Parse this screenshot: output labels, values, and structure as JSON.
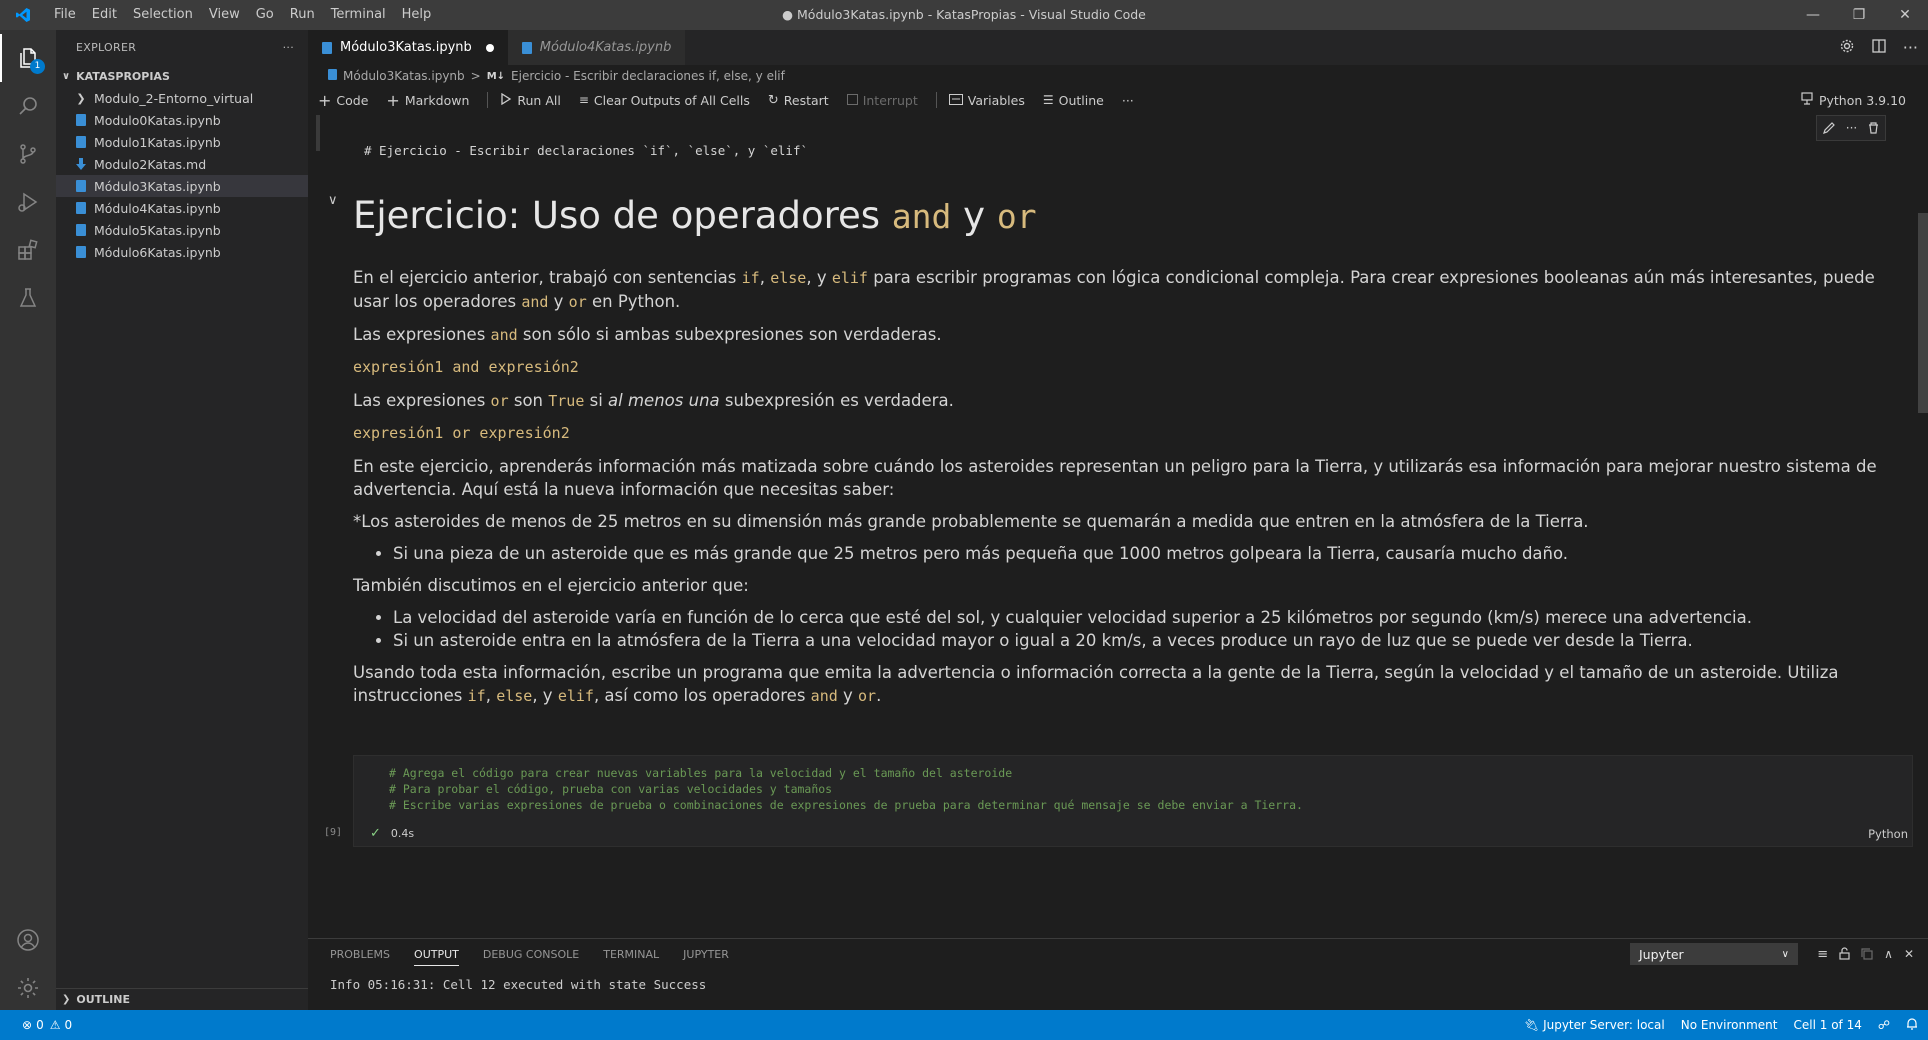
{
  "titlebar": {
    "menu": [
      "File",
      "Edit",
      "Selection",
      "View",
      "Go",
      "Run",
      "Terminal",
      "Help"
    ],
    "title": "● Módulo3Katas.ipynb - KatasPropias - Visual Studio Code"
  },
  "activity": {
    "explorer_badge": "1"
  },
  "sidebar": {
    "header": "EXPLORER",
    "section": "KATASPROPIAS",
    "items": [
      {
        "label": "Modulo_2-Entorno_virtual",
        "type": "folder"
      },
      {
        "label": "Modulo0Katas.ipynb",
        "type": "notebook"
      },
      {
        "label": "Modulo1Katas.ipynb",
        "type": "notebook"
      },
      {
        "label": "Modulo2Katas.md",
        "type": "markdown"
      },
      {
        "label": "Módulo3Katas.ipynb",
        "type": "notebook"
      },
      {
        "label": "Módulo4Katas.ipynb",
        "type": "notebook"
      },
      {
        "label": "Módulo5Katas.ipynb",
        "type": "notebook"
      },
      {
        "label": "Módulo6Katas.ipynb",
        "type": "notebook"
      }
    ],
    "outline": "OUTLINE"
  },
  "tabs": [
    {
      "label": "Módulo3Katas.ipynb"
    },
    {
      "label": "Módulo4Katas.ipynb"
    }
  ],
  "breadcrumb": {
    "file": "Módulo3Katas.ipynb",
    "sep": ">",
    "md_prefix": "M↓",
    "cell": "Ejercicio - Escribir declaraciones if, else, y elif"
  },
  "toolbar": {
    "code": "Code",
    "markdown": "Markdown",
    "run_all": "Run All",
    "clear_outputs": "Clear Outputs of All Cells",
    "restart": "Restart",
    "interrupt": "Interrupt",
    "variables": "Variables",
    "outline": "Outline",
    "more": "···",
    "kernel": "Python 3.9.10"
  },
  "raw_cell": {
    "text": "# Ejercicio - Escribir declaraciones `if`, `else`, y `elif`"
  },
  "markdown": {
    "h1_a": "Ejercicio: Uso de operadores ",
    "h1_code1": "and",
    "h1_b": " y ",
    "h1_code2": "or",
    "p1_a": "En el ejercicio anterior, trabajó con sentencias ",
    "p1_c1": "if",
    "p1_s1": ", ",
    "p1_c2": "else",
    "p1_s2": ", y ",
    "p1_c3": "elif",
    "p1_b": " para escribir programas con lógica condicional compleja. Para crear expresiones booleanas aún más interesantes, puede usar los operadores ",
    "p1_c4": "and",
    "p1_s3": " y ",
    "p1_c5": "or",
    "p1_end": " en Python.",
    "p2_a": "Las expresiones ",
    "p2_c": "and",
    "p2_b": " son sólo si ambas subexpresiones son verdaderas.",
    "code1": "expresión1 and expresión2",
    "p3_a": "Las expresiones ",
    "p3_c1": "or",
    "p3_b": " son ",
    "p3_c2": "True",
    "p3_c": " si ",
    "p3_em": "al menos una",
    "p3_d": " subexpresión es verdadera.",
    "code2": "expresión1 or expresión2",
    "p4": "En este ejercicio, aprenderás información más matizada sobre cuándo los asteroides representan un peligro para la Tierra, y utilizarás esa información para mejorar nuestro sistema de advertencia. Aquí está la nueva información que necesitas saber:",
    "p5": "*Los asteroides de menos de 25 metros en su dimensión más grande probablemente se quemarán a medida que entren en la atmósfera de la Tierra.",
    "li1": "Si una pieza de un asteroide que es más grande que 25 metros pero más pequeña que 1000 metros golpeara la Tierra, causaría mucho daño.",
    "p6": "También discutimos en el ejercicio anterior que:",
    "li2": "La velocidad del asteroide varía en función de lo cerca que esté del sol, y cualquier velocidad superior a 25 kilómetros por segundo (km/s) merece una advertencia.",
    "li3": "Si un asteroide entra en la atmósfera de la Tierra a una velocidad mayor o igual a 20 km/s, a veces produce un rayo de luz que se puede ver desde la Tierra.",
    "p7_a": "Usando toda esta información, escribe un programa que emita la advertencia o información correcta a la gente de la Tierra, según la velocidad y el tamaño de un asteroide. Utiliza instrucciones ",
    "p7_c1": "if",
    "p7_s1": ", ",
    "p7_c2": "else",
    "p7_s2": ", y ",
    "p7_c3": "elif",
    "p7_b": ", así como los operadores ",
    "p7_c4": "and",
    "p7_s3": " y ",
    "p7_c5": "or",
    "p7_end": "."
  },
  "code_cell": {
    "lines": [
      "# Agrega el código para crear nuevas variables para la velocidad y el tamaño del asteroide",
      "# Para probar el código, prueba con varias velocidades y tamaños",
      "# Escribe varias expresiones de prueba o combinaciones de expresiones de prueba para determinar qué mensaje se debe enviar a Tierra."
    ],
    "exec_count": "[9]",
    "exec_time": "0.4s",
    "language": "Python"
  },
  "panel": {
    "tabs": [
      "PROBLEMS",
      "OUTPUT",
      "DEBUG CONSOLE",
      "TERMINAL",
      "JUPYTER"
    ],
    "active_tab": "OUTPUT",
    "channel": "Jupyter",
    "output": "Info 05:16:31: Cell 12 executed with state Success"
  },
  "statusbar": {
    "errors": "0",
    "warnings": "0",
    "jupyter_server": "Jupyter Server: local",
    "environment": "No Environment",
    "cell_pos": "Cell 1 of 14"
  },
  "colors": {
    "accent": "#007acc",
    "code_inline": "#d7ba7d",
    "comment": "#6a9955"
  }
}
